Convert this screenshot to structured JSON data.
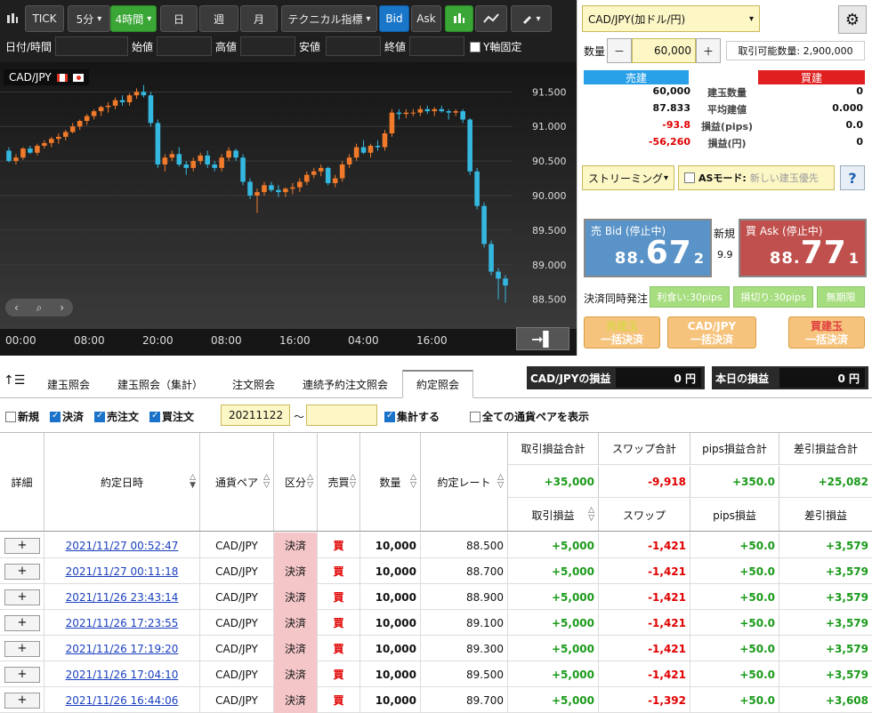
{
  "toolbar": {
    "tick": "TICK",
    "m5": "5分",
    "h4": "4時間",
    "day": "日",
    "week": "週",
    "month": "月",
    "tech": "テクニカル指標",
    "bid": "Bid",
    "ask": "Ask"
  },
  "filter": {
    "datetime": "日付/時間",
    "open": "始値",
    "high": "高値",
    "low": "安値",
    "close": "終値",
    "yfix": "Y軸固定"
  },
  "chart": {
    "symbol": "CAD/JPY"
  },
  "chart_data": {
    "type": "candlestick",
    "y_ticks": [
      "91.500",
      "91.000",
      "90.500",
      "90.000",
      "89.500",
      "89.000",
      "88.500"
    ],
    "ylim": [
      88.2,
      91.8
    ],
    "x_ticks": [
      "00:00",
      "08:00",
      "20:00",
      "08:00",
      "16:00",
      "04:00",
      "16:00"
    ],
    "candles": [
      [
        90.65,
        90.7,
        90.48,
        90.5
      ],
      [
        90.5,
        90.6,
        90.45,
        90.55
      ],
      [
        90.55,
        90.7,
        90.52,
        90.68
      ],
      [
        90.68,
        90.72,
        90.6,
        90.62
      ],
      [
        90.62,
        90.75,
        90.58,
        90.72
      ],
      [
        90.72,
        90.8,
        90.68,
        90.76
      ],
      [
        90.76,
        90.85,
        90.7,
        90.82
      ],
      [
        90.82,
        90.9,
        90.75,
        90.85
      ],
      [
        90.85,
        90.95,
        90.8,
        90.92
      ],
      [
        90.92,
        91.05,
        90.9,
        91.0
      ],
      [
        91.0,
        91.1,
        90.95,
        91.08
      ],
      [
        91.08,
        91.18,
        91.02,
        91.15
      ],
      [
        91.15,
        91.25,
        91.1,
        91.22
      ],
      [
        91.22,
        91.3,
        91.15,
        91.28
      ],
      [
        91.28,
        91.35,
        91.2,
        91.3
      ],
      [
        91.3,
        91.42,
        91.25,
        91.38
      ],
      [
        91.38,
        91.45,
        91.3,
        91.35
      ],
      [
        91.35,
        91.48,
        91.3,
        91.45
      ],
      [
        91.45,
        91.55,
        91.4,
        91.5
      ],
      [
        91.5,
        91.6,
        91.42,
        91.45
      ],
      [
        91.45,
        91.5,
        91.0,
        91.05
      ],
      [
        91.05,
        91.1,
        90.4,
        90.45
      ],
      [
        90.45,
        90.6,
        90.35,
        90.55
      ],
      [
        90.55,
        90.65,
        90.5,
        90.6
      ],
      [
        90.6,
        90.7,
        90.42,
        90.45
      ],
      [
        90.45,
        90.5,
        90.3,
        90.4
      ],
      [
        90.4,
        90.55,
        90.35,
        90.5
      ],
      [
        90.5,
        90.62,
        90.45,
        90.58
      ],
      [
        90.58,
        90.65,
        90.4,
        90.45
      ],
      [
        90.45,
        90.5,
        90.35,
        90.4
      ],
      [
        90.4,
        90.6,
        90.35,
        90.55
      ],
      [
        90.55,
        90.7,
        90.5,
        90.65
      ],
      [
        90.65,
        90.68,
        90.5,
        90.55
      ],
      [
        90.55,
        90.6,
        90.15,
        90.2
      ],
      [
        90.2,
        90.25,
        89.95,
        90.0
      ],
      [
        90.0,
        90.1,
        89.75,
        90.05
      ],
      [
        90.05,
        90.2,
        90.0,
        90.15
      ],
      [
        90.15,
        90.2,
        90.05,
        90.08
      ],
      [
        90.08,
        90.15,
        89.98,
        90.05
      ],
      [
        90.05,
        90.12,
        89.98,
        90.1
      ],
      [
        90.1,
        90.18,
        90.02,
        90.12
      ],
      [
        90.12,
        90.25,
        90.05,
        90.2
      ],
      [
        90.2,
        90.35,
        90.15,
        90.3
      ],
      [
        90.3,
        90.4,
        90.25,
        90.35
      ],
      [
        90.35,
        90.45,
        90.28,
        90.4
      ],
      [
        90.4,
        90.42,
        90.15,
        90.18
      ],
      [
        90.18,
        90.3,
        90.12,
        90.25
      ],
      [
        90.25,
        90.5,
        90.2,
        90.45
      ],
      [
        90.45,
        90.6,
        90.4,
        90.55
      ],
      [
        90.55,
        90.75,
        90.5,
        90.7
      ],
      [
        90.7,
        90.8,
        90.6,
        90.62
      ],
      [
        90.62,
        90.75,
        90.55,
        90.72
      ],
      [
        90.72,
        90.8,
        90.65,
        90.7
      ],
      [
        90.7,
        90.95,
        90.65,
        90.9
      ],
      [
        90.9,
        91.25,
        90.85,
        91.2
      ],
      [
        91.2,
        91.25,
        91.1,
        91.18
      ],
      [
        91.18,
        91.25,
        91.12,
        91.2
      ],
      [
        91.2,
        91.25,
        91.15,
        91.2
      ],
      [
        91.2,
        91.3,
        91.15,
        91.25
      ],
      [
        91.25,
        91.3,
        91.18,
        91.22
      ],
      [
        91.22,
        91.28,
        91.15,
        91.25
      ],
      [
        91.25,
        91.3,
        91.2,
        91.22
      ],
      [
        91.22,
        91.25,
        91.1,
        91.2
      ],
      [
        91.2,
        91.25,
        91.15,
        91.22
      ],
      [
        91.22,
        91.25,
        91.05,
        91.1
      ],
      [
        91.1,
        91.12,
        90.3,
        90.35
      ],
      [
        90.35,
        90.4,
        89.8,
        89.85
      ],
      [
        89.85,
        89.9,
        89.25,
        89.3
      ],
      [
        89.3,
        89.35,
        88.85,
        88.9
      ],
      [
        88.9,
        88.95,
        88.5,
        88.8
      ],
      [
        88.8,
        88.85,
        88.45,
        88.7
      ]
    ]
  },
  "order": {
    "pair": "CAD/JPY(加ドル/円)",
    "qty_label": "数量",
    "minus": "－",
    "qty": "60,000",
    "plus": "＋",
    "avail": "取引可能数量: 2,900,000",
    "sell_head": "売建",
    "buy_head": "買建",
    "stats": [
      {
        "sell": "60,000",
        "label": "建玉数量",
        "buy": "0"
      },
      {
        "sell": "87.833",
        "label": "平均建値",
        "buy": "0.000"
      },
      {
        "sell": "-93.8",
        "label": "損益(pips)",
        "buy": "0.0"
      },
      {
        "sell": "-56,260",
        "label": "損益(円)",
        "buy": "0"
      }
    ],
    "streaming": "ストリーミング",
    "as_mode": "ASモード:",
    "as_placeholder": "新しい建玉優先",
    "help": "?",
    "bid_label": "売 Bid (停止中)",
    "bid_pre": "88.",
    "bid_big": "67",
    "bid_small": "2",
    "ask_label": "買 Ask (停止中)",
    "ask_pre": "88.",
    "ask_big": "77",
    "ask_small": "1",
    "new_label": "新規",
    "spread": "9.9",
    "settle_label": "決済同時発注",
    "tp": "利食い:30pips",
    "sl": "損切り:30pips",
    "unlimited": "無期限",
    "btn_sell_1": "売建玉",
    "btn_sell_2": "一括決済",
    "btn_pair_1": "CAD/JPY",
    "btn_pair_2": "一括決済",
    "btn_buy_1": "買建玉",
    "btn_buy_2": "一括決済"
  },
  "tabs": [
    "建玉照会",
    "建玉照会（集計）",
    "注文照会",
    "連続予約注文照会",
    "約定照会"
  ],
  "pl": {
    "pair_label": "CAD/JPYの損益",
    "pair_val": "0 円",
    "today_label": "本日の損益",
    "today_val": "0 円"
  },
  "filters": {
    "new": "新規",
    "settle": "決済",
    "sell": "売注文",
    "buy": "買注文",
    "date_from": "20211122",
    "tilde": "～",
    "agg": "集計する",
    "allpairs": "全ての通貨ペアを表示"
  },
  "table": {
    "headers": {
      "detail": "詳細",
      "datetime": "約定日時",
      "pair": "通貨ペア",
      "kind": "区分",
      "side": "売買",
      "qty": "数量",
      "rate": "約定レート",
      "trade_total": "取引損益合計",
      "swap_total": "スワップ合計",
      "pips_total": "pips損益合計",
      "net_total": "差引損益合計",
      "trade": "取引損益",
      "swap": "スワップ",
      "pips": "pips損益",
      "net": "差引損益"
    },
    "totals": {
      "trade": "+35,000",
      "swap": "-9,918",
      "pips": "+350.0",
      "net": "+25,082"
    },
    "rows": [
      {
        "dt": "2021/11/27 00:52:47",
        "pair": "CAD/JPY",
        "kind": "決済",
        "side": "買",
        "qty": "10,000",
        "rate": "88.500",
        "trade": "+5,000",
        "swap": "-1,421",
        "pips": "+50.0",
        "net": "+3,579"
      },
      {
        "dt": "2021/11/27 00:11:18",
        "pair": "CAD/JPY",
        "kind": "決済",
        "side": "買",
        "qty": "10,000",
        "rate": "88.700",
        "trade": "+5,000",
        "swap": "-1,421",
        "pips": "+50.0",
        "net": "+3,579"
      },
      {
        "dt": "2021/11/26 23:43:14",
        "pair": "CAD/JPY",
        "kind": "決済",
        "side": "買",
        "qty": "10,000",
        "rate": "88.900",
        "trade": "+5,000",
        "swap": "-1,421",
        "pips": "+50.0",
        "net": "+3,579"
      },
      {
        "dt": "2021/11/26 17:23:55",
        "pair": "CAD/JPY",
        "kind": "決済",
        "side": "買",
        "qty": "10,000",
        "rate": "89.100",
        "trade": "+5,000",
        "swap": "-1,421",
        "pips": "+50.0",
        "net": "+3,579"
      },
      {
        "dt": "2021/11/26 17:19:20",
        "pair": "CAD/JPY",
        "kind": "決済",
        "side": "買",
        "qty": "10,000",
        "rate": "89.300",
        "trade": "+5,000",
        "swap": "-1,421",
        "pips": "+50.0",
        "net": "+3,579"
      },
      {
        "dt": "2021/11/26 17:04:10",
        "pair": "CAD/JPY",
        "kind": "決済",
        "side": "買",
        "qty": "10,000",
        "rate": "89.500",
        "trade": "+5,000",
        "swap": "-1,421",
        "pips": "+50.0",
        "net": "+3,579"
      },
      {
        "dt": "2021/11/26 16:44:06",
        "pair": "CAD/JPY",
        "kind": "決済",
        "side": "買",
        "qty": "10,000",
        "rate": "89.700",
        "trade": "+5,000",
        "swap": "-1,392",
        "pips": "+50.0",
        "net": "+3,608"
      }
    ]
  },
  "colors": {
    "up": "#f07a2a",
    "down": "#35b8e0",
    "bid_bg": "#5a93c8",
    "ask_bg": "#c0504d"
  }
}
